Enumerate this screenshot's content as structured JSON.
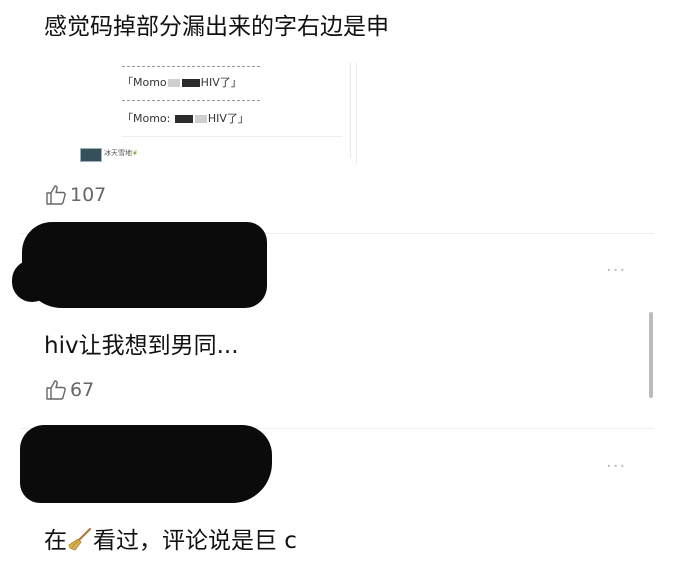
{
  "comments": [
    {
      "text": "感觉码掉部分漏出来的字右边是申",
      "embed": {
        "quote1": "「Momo",
        "quote1_suffix": "HIV了」",
        "quote2": "「Momo: ",
        "quote2_suffix": "HIV了」",
        "username": "冰天雪地"
      },
      "likes": "107"
    },
    {
      "text": "hiv让我想到男同...",
      "likes": "67",
      "more": "···"
    },
    {
      "text_before": "在",
      "text_after": "看过，评论说是巨 c",
      "emoji_icon": "broom-icon",
      "more": "···"
    }
  ]
}
